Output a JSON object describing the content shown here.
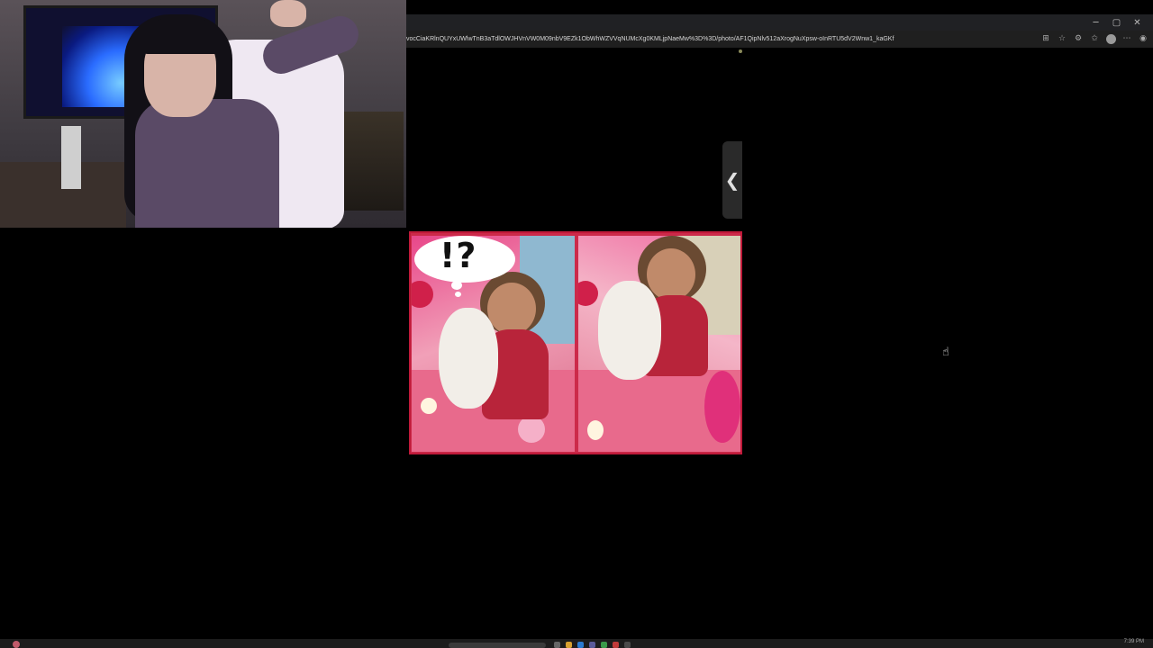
{
  "browser": {
    "url": "vocCiaKRlnQUYxUWlwTnB3aTdlOWJHVnVW0M09nbV9EZk1ObWhWZVVqNUMcXg0KMLjpNaeMw%3D%3D/photo/AF1QipNlv512aXrogNuXpsw-oInRTU5dV2Wnw1_kaGKf",
    "window_controls": [
      "─",
      "▢",
      "✕"
    ],
    "toolbar_icons": [
      "apps-icon",
      "star-icon",
      "extensions-icon",
      "favorites-icon",
      "profile-icon",
      "more-icon",
      "copilot-icon"
    ]
  },
  "viewer": {
    "prev_label": "❮",
    "photo": {
      "thought_bubble_text": "!?",
      "frame_color": "#c01a3a"
    }
  },
  "webcam": {
    "present": true
  },
  "cursor": "hand-pointer-icon",
  "taskbar": {
    "clock": "7:39 PM"
  }
}
